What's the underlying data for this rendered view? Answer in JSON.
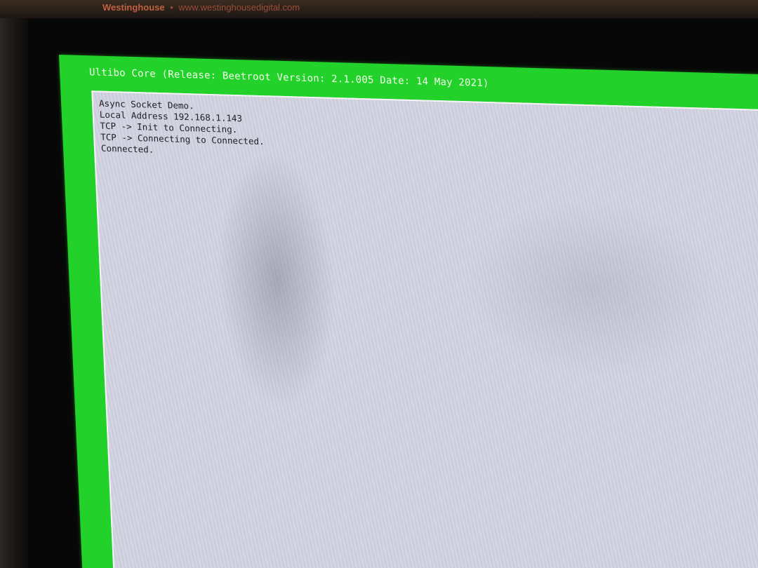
{
  "monitor": {
    "brand_name": "Westinghouse",
    "brand_separator": "•",
    "brand_url": "www.westinghousedigital.com"
  },
  "screen": {
    "title": "Ultibo Core (Release: Beetroot Version: 2.1.005 Date: 14 May 2021)",
    "console_lines": [
      "Async Socket Demo.",
      "Local Address 192.168.1.143",
      "TCP -> Init to Connecting.",
      "TCP -> Connecting to Connected.",
      "Connected."
    ]
  },
  "colors": {
    "screen_border": "#22d12a",
    "console_background": "#d4d4e2",
    "console_text": "#1e1e24",
    "title_text": "#f2ffe8",
    "brand_text": "#c0623f"
  }
}
